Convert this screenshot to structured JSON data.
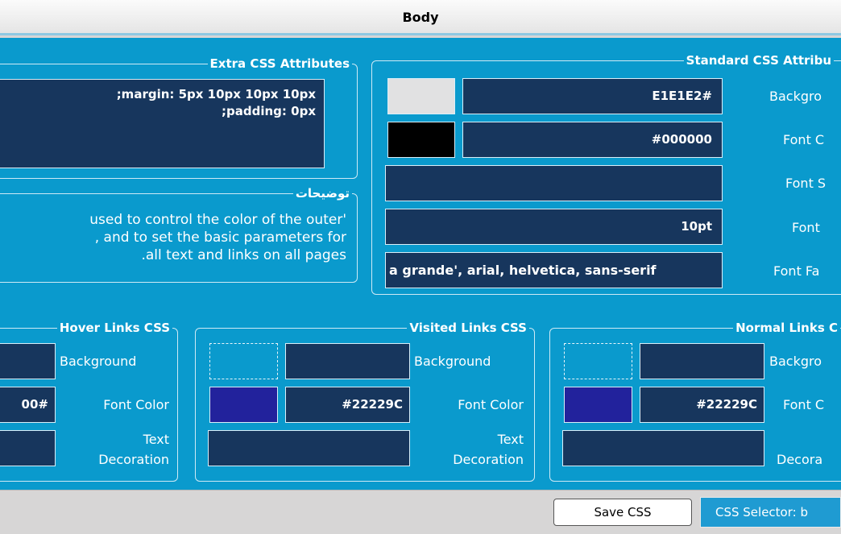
{
  "header": {
    "title": "Body"
  },
  "extra_css": {
    "legend": "Extra CSS Attributes",
    "line1": ";margin: 5px 10px 10px 10px",
    "line2": ";padding: 0px"
  },
  "notes": {
    "legend": "توضيحات",
    "line1": "used to control the color of the outer'",
    "line2": ", and to set the basic parameters for",
    "line3": ".all text and links on all pages"
  },
  "standard_css": {
    "legend": "Standard CSS Attribu",
    "background_value": "E1E1E2#",
    "background_color": "#e1e1e2",
    "font_color_value": "#000000",
    "font_color": "#000000",
    "font_size_value": "10pt",
    "font_family_value": "a grande', arial, helvetica, sans-serif",
    "labels": {
      "background": "Backgro",
      "font_color": "Font C",
      "font_s": "Font S",
      "font": "Font",
      "font_family": "Font Fa"
    }
  },
  "hover_links": {
    "legend": "Hover Links CSS",
    "font_color_value": "00#",
    "labels": {
      "background": "Background",
      "font_color": "Font Color",
      "text": "Text",
      "decoration": "Decoration"
    }
  },
  "visited_links": {
    "legend": "Visited Links CSS",
    "font_color_value": "#22229C",
    "swatch_color": "#22229c",
    "labels": {
      "background": "Background",
      "font_color": "Font Color",
      "text": "Text",
      "decoration": "Decoration"
    }
  },
  "normal_links": {
    "legend": "Normal Links C",
    "font_color_value": "#22229C",
    "swatch_color": "#22229c",
    "labels": {
      "background": "Backgro",
      "font_color": "Font C",
      "decoration": "Decora"
    }
  },
  "footer": {
    "save_label": "Save CSS",
    "selector_text": "CSS Selector: b"
  }
}
